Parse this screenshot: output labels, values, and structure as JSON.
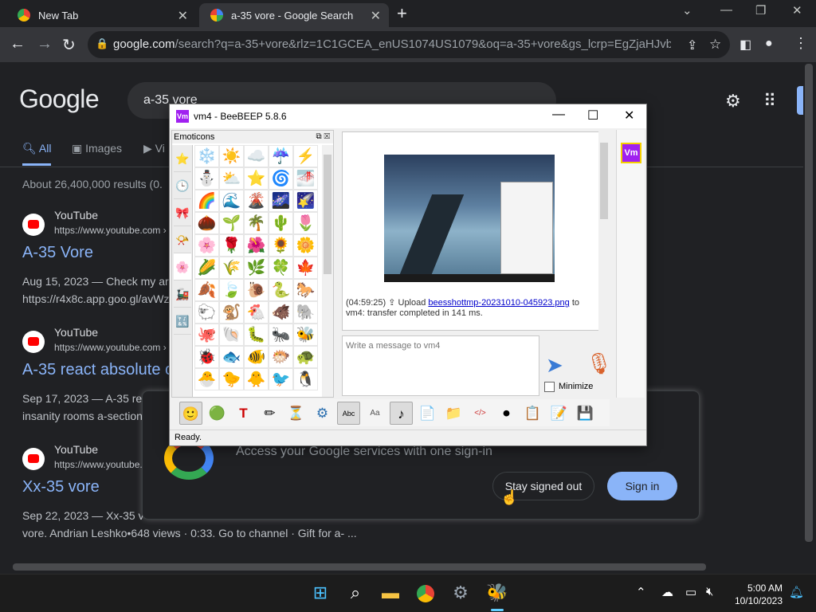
{
  "browser": {
    "tabs": [
      {
        "title": "New Tab",
        "active": false
      },
      {
        "title": "a-35 vore - Google Search",
        "active": true
      }
    ],
    "url_host": "google.com",
    "url_rest": "/search?q=a-35+vore&rlz=1C1GCEA_enUS1074US1079&oq=a-35+vore&gs_lcrp=EgZjaHJvbWUyBg..."
  },
  "google": {
    "logo": "Google",
    "query": "a-35 vore",
    "nav_tabs": [
      "All",
      "Images",
      "Vi"
    ],
    "stats": "About 26,400,000 results (0.",
    "results": [
      {
        "site": "YouTube",
        "url": "https://www.youtube.com ›",
        "title": "A-35 Vore",
        "snippet": "Aug 15, 2023 — Check my ar",
        "snippet2": "https://r4x8c.app.goo.gl/avWz"
      },
      {
        "site": "YouTube",
        "url": "https://www.youtube.com ›",
        "title": "A-35 react absolute c",
        "snippet": "Sep 17, 2023 — A-35 react a",
        "snippet2": "insanity rooms a-section"
      },
      {
        "site": "YouTube",
        "url": "https://www.youtube.",
        "title": "Xx-35 vore",
        "snippet": "Sep 22, 2023 — Xx-35 v",
        "snippet2": "vore. Andrian Leshko•648 views · 0:33. Go to channel · Gift for a- ..."
      }
    ],
    "signin_prompt": "Access your Google services with one sign-in",
    "stay_signed_out": "Stay signed out",
    "sign_in": "Sign in"
  },
  "beebeep": {
    "title": "vm4 - BeeBEEP 5.8.6",
    "emoticons_label": "Emoticons",
    "emoticons": [
      "❄️",
      "☀️",
      "☁️",
      "☔",
      "⚡",
      "⛄",
      "⛅",
      "⭐",
      "🌀",
      "🌁",
      "🌈",
      "🌊",
      "🌋",
      "🌌",
      "🌠",
      "🌰",
      "🌱",
      "🌴",
      "🌵",
      "🌷",
      "🌸",
      "🌹",
      "🌺",
      "🌻",
      "🌼",
      "🌽",
      "🌾",
      "🌿",
      "🍀",
      "🍁",
      "🍂",
      "🍃",
      "🐌",
      "🐍",
      "🐎",
      "🐑",
      "🐒",
      "🐔",
      "🐗",
      "🐘",
      "🐙",
      "🐚",
      "🐛",
      "🐜",
      "🐝",
      "🐞",
      "🐟",
      "🐠",
      "🐡",
      "🐢",
      "🐣",
      "🐤",
      "🐥",
      "🐦",
      "🐧"
    ],
    "side_tabs": [
      "⭐",
      "🕒",
      "🎀",
      "📯",
      "🌸",
      "🚂",
      "🔣"
    ],
    "message_time": "(04:59:25)",
    "message_prefix": "Upload",
    "message_file": "beesshottmp-20231010-045923.png",
    "message_suffix": "to",
    "message_line2": "vm4: transfer completed in 141 ms.",
    "input_placeholder": "Write a message to vm4",
    "minimize_label": "Minimize",
    "user_avatar": "Vm",
    "status": "Ready.",
    "toolbar_icons": [
      "🙂",
      "🟢",
      "T",
      "✏",
      "⏳",
      "⚙",
      "Abc",
      "Aa",
      "♪",
      "📄",
      "📁",
      "</>",
      "⏺",
      "📋",
      "📝",
      "💾"
    ]
  },
  "taskbar": {
    "time": "5:00 AM",
    "date": "10/10/2023"
  }
}
